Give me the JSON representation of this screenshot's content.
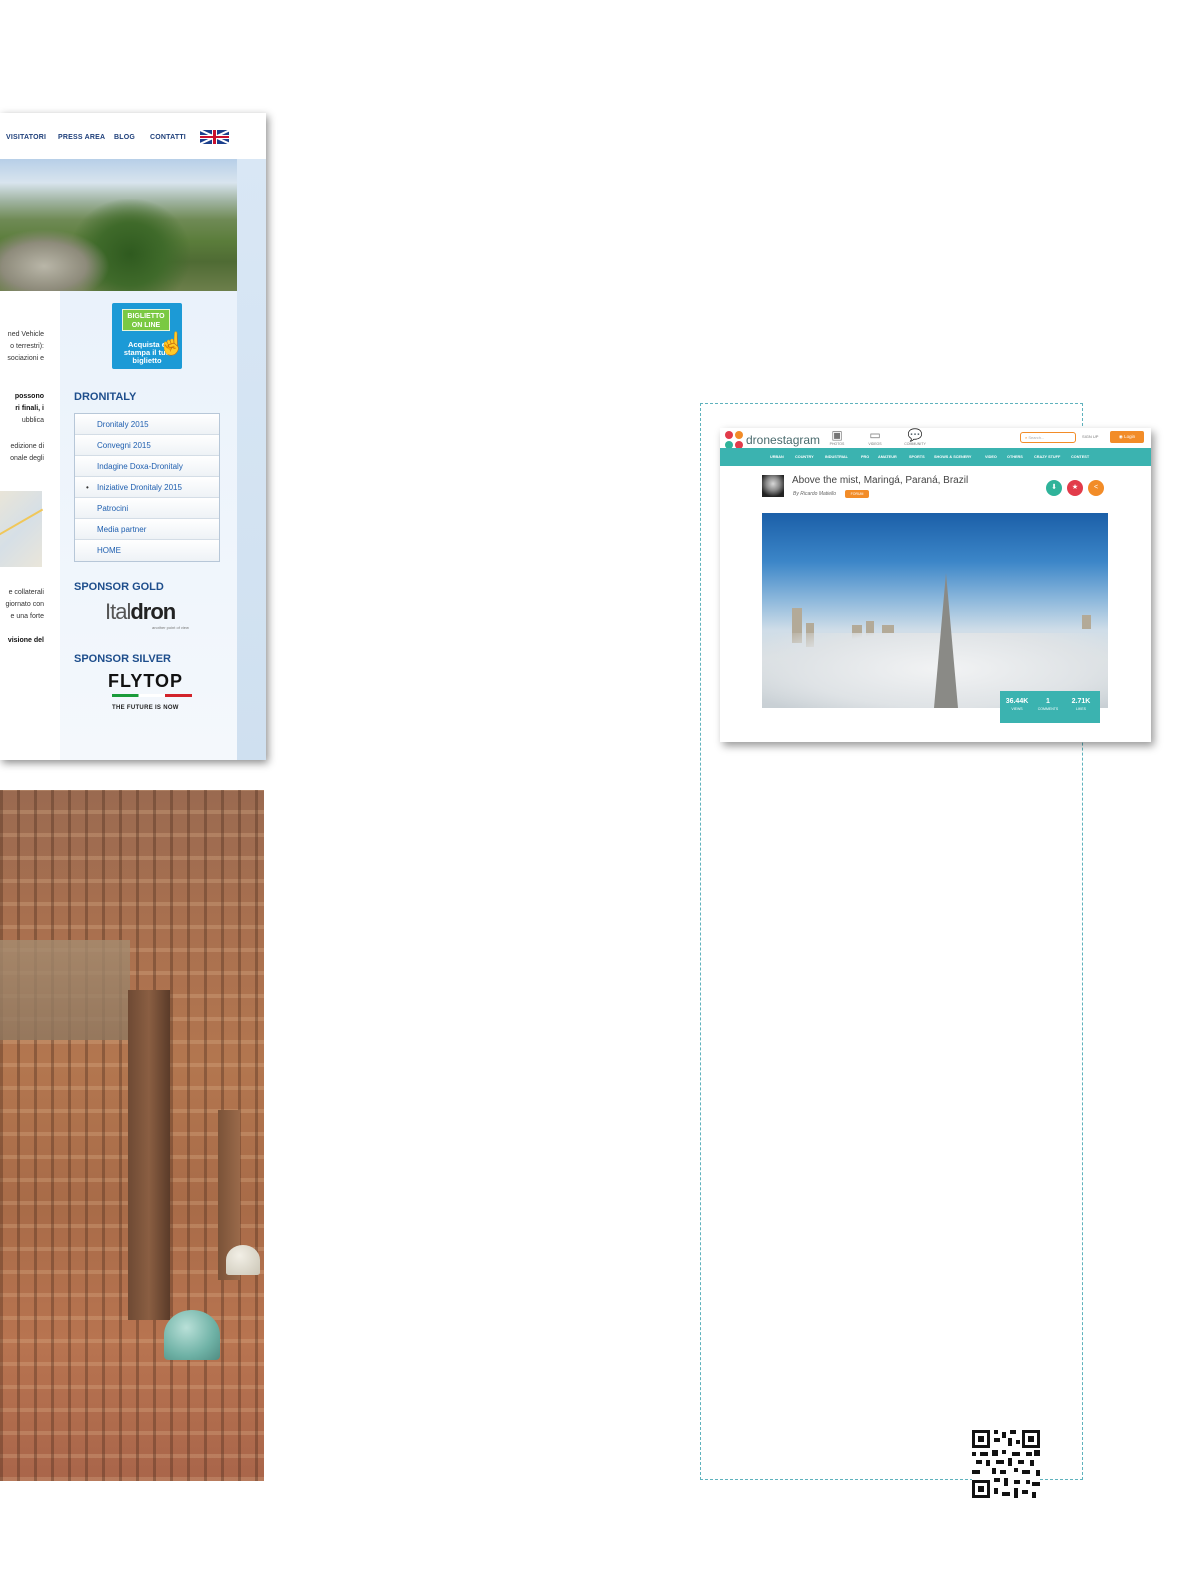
{
  "site": {
    "nav": [
      "VISITATORI",
      "PRESS AREA",
      "BLOG",
      "CONTATTI"
    ],
    "content_snippets": [
      {
        "text": "ned Vehicle",
        "bold": false
      },
      {
        "text": "o terrestri):",
        "bold": false
      },
      {
        "text": "sociazioni e",
        "bold": false
      },
      {
        "text": "possono",
        "bold": true
      },
      {
        "text": "ri finali, i",
        "bold": true
      },
      {
        "text": "ubblica",
        "bold": false
      },
      {
        "text": "edizione di",
        "bold": false
      },
      {
        "text": "onale degli",
        "bold": false
      },
      {
        "text": "e collaterali",
        "bold": false
      },
      {
        "text": "giornato con",
        "bold": false
      },
      {
        "text": "e una forte",
        "bold": false
      },
      {
        "text": "visione del",
        "bold": true
      }
    ],
    "ticket": {
      "top": "BIGLIETTO ON LINE",
      "bottom": "Acquista e stampa il tuo biglietto"
    },
    "section_dronitaly": "DRONITALY",
    "menu": [
      "Dronitaly 2015",
      "Convegni 2015",
      "Indagine Doxa-Dronitaly",
      "Iniziative Dronitaly 2015",
      "Patrocini",
      "Media partner",
      "HOME"
    ],
    "menu_active_index": 3,
    "sponsor_gold_title": "SPONSOR GOLD",
    "sponsor_gold_logo": {
      "part1": "Ital",
      "part2": "dron",
      "sub": "another point of view"
    },
    "sponsor_silver_title": "SPONSOR SILVER",
    "sponsor_silver_logo": {
      "name": "FLYTOP",
      "tagline": "THE FUTURE IS NOW"
    }
  },
  "dronestagram": {
    "logo_text": "dronestagram",
    "nav": [
      {
        "icon": "camera-icon",
        "label": "PHOTOS"
      },
      {
        "icon": "video-icon",
        "label": "VIDEOS"
      },
      {
        "icon": "chat-icon",
        "label": "COMMUNITY"
      }
    ],
    "search_placeholder": "Search...",
    "signup_label": "SIGN UP",
    "login_label": "Login",
    "categories": [
      "URBAN",
      "COUNTRY",
      "INDUSTRIAL",
      "PRO",
      "AMATEUR",
      "SPORTS",
      "SHOWS & SCENERY",
      "VIDEO",
      "OTHERS",
      "CRAZY STUFF",
      "CONTEST"
    ],
    "post_title": "Above the mist, Maringá, Paraná, Brazil",
    "byline": "By Ricardo Matiello",
    "badge": "FORUM",
    "stats": [
      {
        "value": "36.44K",
        "label": "VIEWS"
      },
      {
        "value": "1",
        "label": "COMMENTS"
      },
      {
        "value": "2.71K",
        "label": "LIKES"
      }
    ],
    "colors": {
      "teal": "#3bb3b0",
      "orange": "#f28c28",
      "red": "#e23b4a",
      "green": "#2fb39a"
    }
  }
}
